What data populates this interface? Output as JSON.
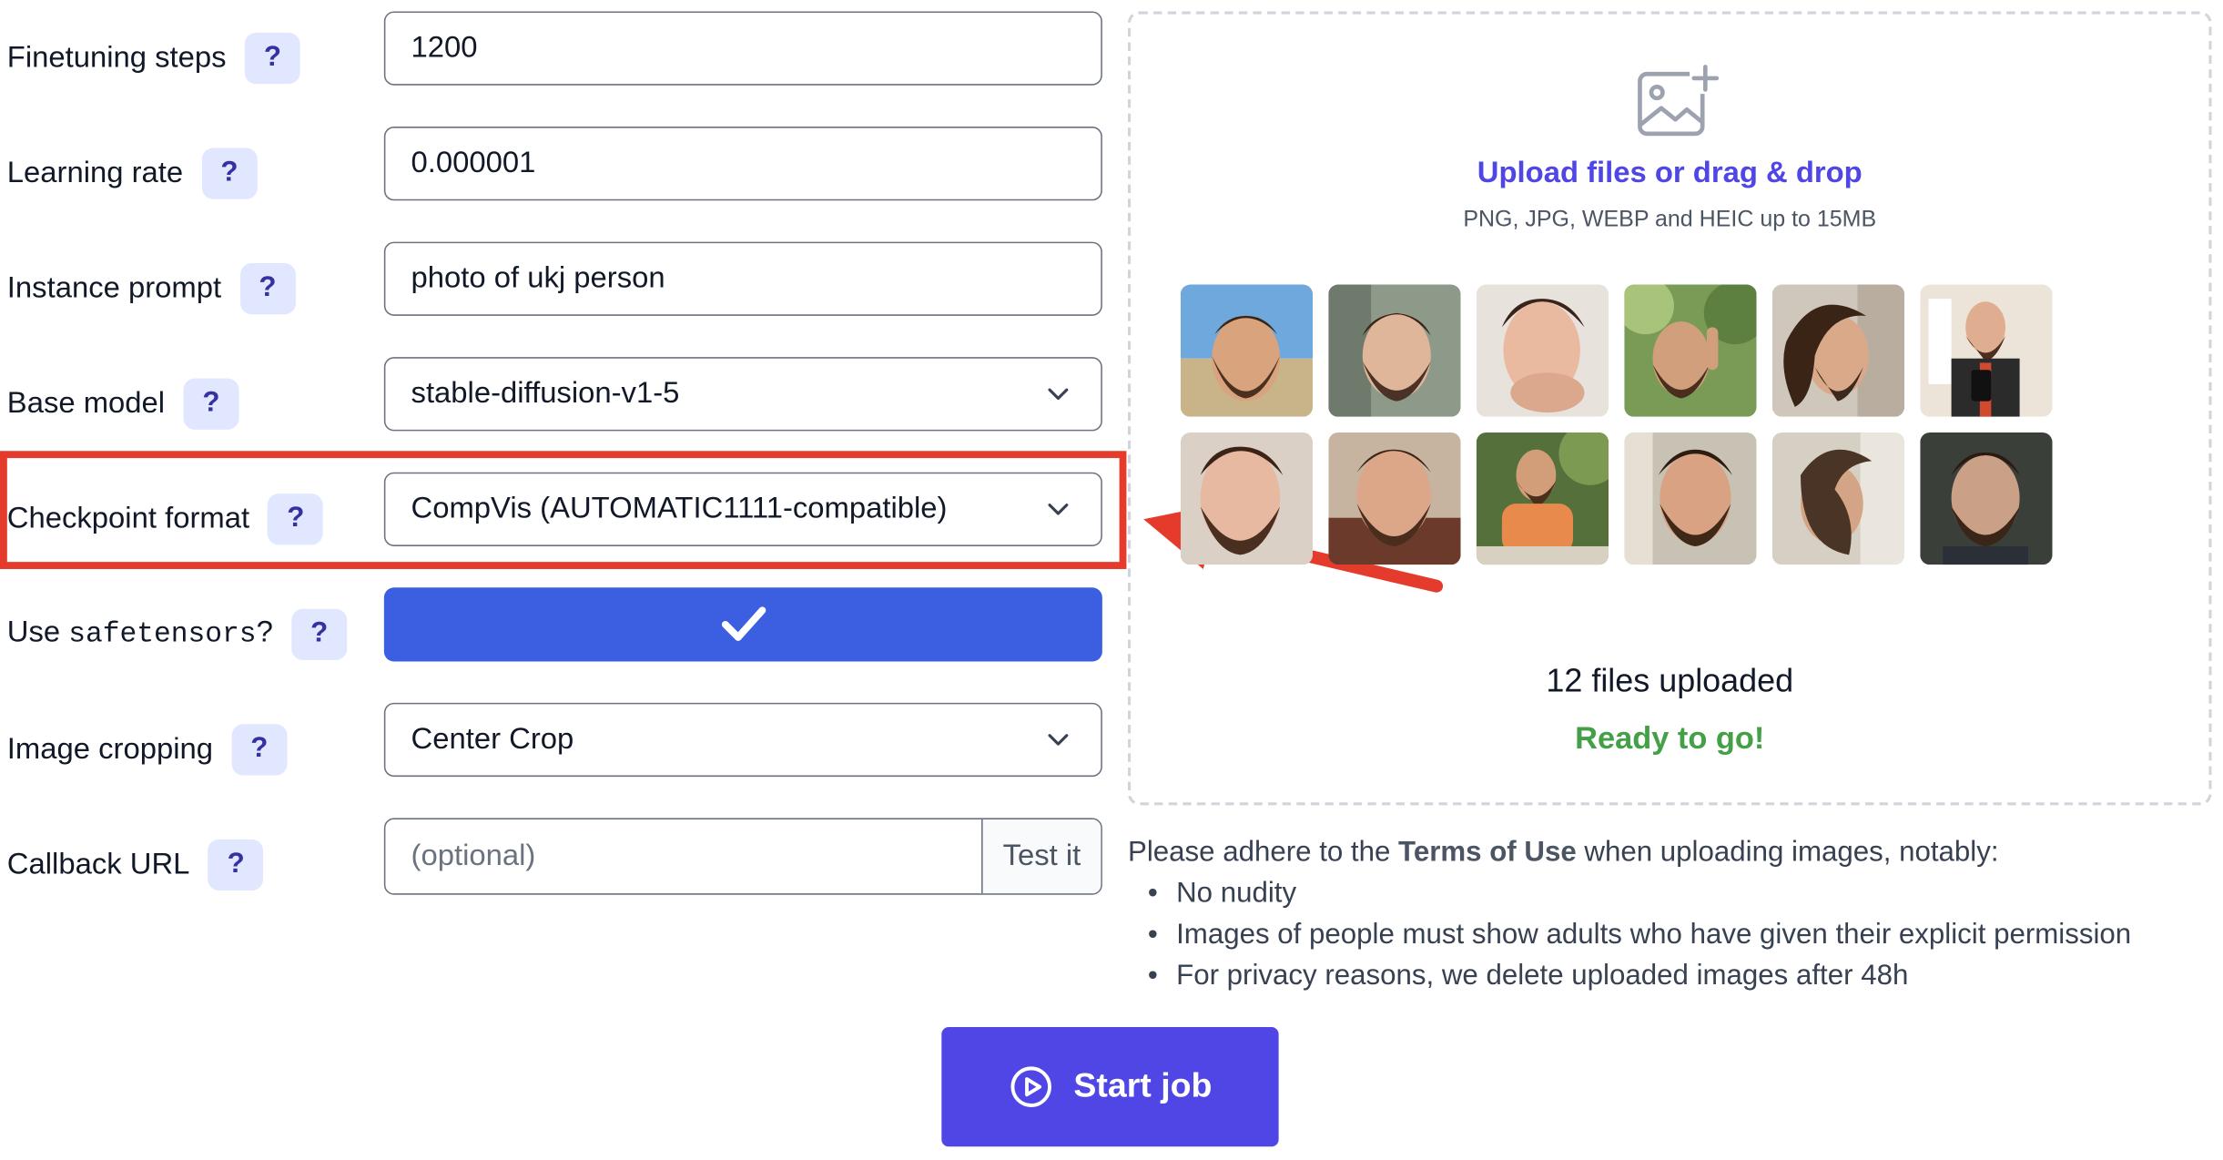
{
  "form": {
    "help_symbol": "?",
    "finetuning_steps": {
      "label": "Finetuning steps",
      "value": "1200"
    },
    "learning_rate": {
      "label": "Learning rate",
      "value": "0.000001"
    },
    "instance_prompt": {
      "label": "Instance prompt",
      "value": "photo of ukj person"
    },
    "base_model": {
      "label": "Base model",
      "value": "stable-diffusion-v1-5"
    },
    "checkpoint_format": {
      "label": "Checkpoint format",
      "value": "CompVis (AUTOMATIC1111-compatible)"
    },
    "safetensors": {
      "label_prefix": "Use ",
      "label_code": "safetensors",
      "label_suffix": "?",
      "checked": true
    },
    "image_cropping": {
      "label": "Image cropping",
      "value": "Center Crop"
    },
    "callback_url": {
      "label": "Callback URL",
      "placeholder": "(optional)",
      "test_label": "Test it"
    }
  },
  "upload": {
    "link_text": "Upload files or drag & drop",
    "hint": "PNG, JPG, WEBP and HEIC up to 15MB",
    "files_count": "12 files uploaded",
    "status": "Ready to go!"
  },
  "terms": {
    "intro_before": "Please adhere to the ",
    "link": "Terms of Use",
    "intro_after": " when uploading images, notably:",
    "items": [
      "No nudity",
      "Images of people must show adults who have given their explicit permission",
      "For privacy reasons, we delete uploaded images after 48h"
    ]
  },
  "actions": {
    "start_label": "Start job"
  },
  "colors": {
    "accent": "#4f46e5",
    "toggle": "#3b5fe0",
    "highlight": "#e53b2c",
    "ready": "#43a047"
  }
}
